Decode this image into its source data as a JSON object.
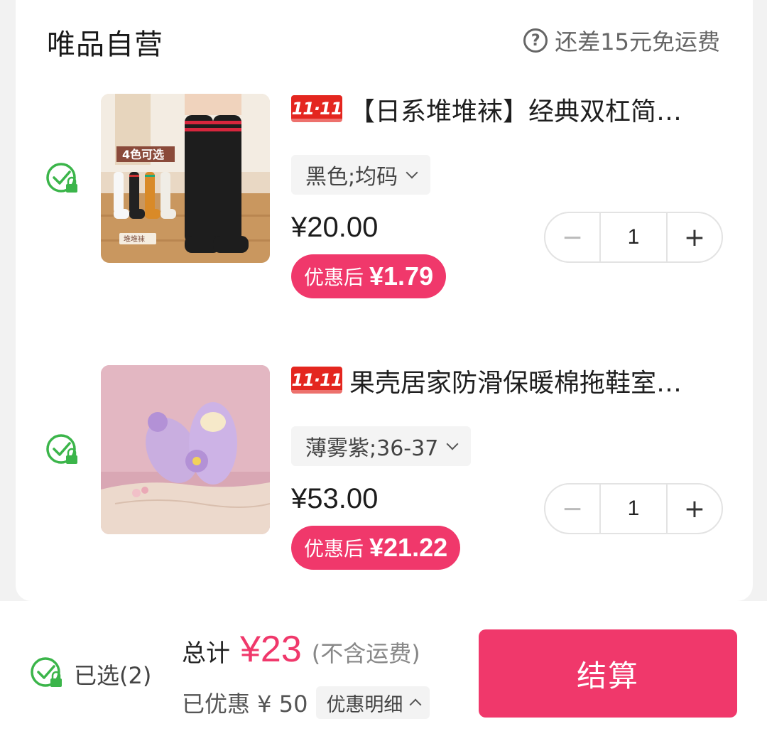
{
  "store": {
    "title": "唯品自营",
    "shipping_tip": "还差15元免运费"
  },
  "items": [
    {
      "tag": "11·11",
      "name": "【日系堆堆袜】经典双杠简…",
      "sku": "黑色;均码",
      "price": "¥20.00",
      "after_label": "优惠后",
      "after_price": "¥1.79",
      "quantity": "1",
      "image_text": "4色可选",
      "image_sub": "堆堆袜"
    },
    {
      "tag": "11·11",
      "name": "果壳居家防滑保暖棉拖鞋室…",
      "sku": "薄雾紫;36-37",
      "price": "¥53.00",
      "after_label": "优惠后",
      "after_price": "¥21.22",
      "quantity": "1"
    }
  ],
  "stepper": {
    "minus": "−",
    "plus": "+"
  },
  "footer": {
    "selected": "已选(2)",
    "total_label": "总计",
    "total_amount": "¥23",
    "total_note": "(不含运费)",
    "discount": "已优惠 ¥ 50",
    "discount_detail": "优惠明细",
    "checkout": "结算"
  },
  "colors": {
    "accent": "#f0386b",
    "check": "#3bb54a",
    "tag": "#e4261f"
  }
}
